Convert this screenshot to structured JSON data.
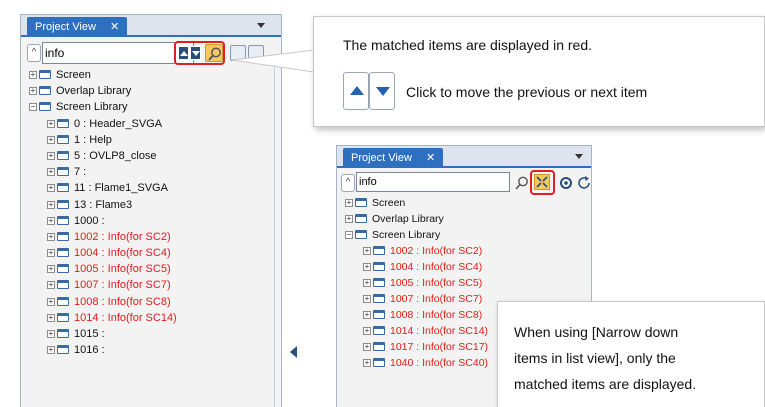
{
  "left_panel": {
    "tab_label": "Project View",
    "tab_close": "✕",
    "collapse_symbol": "^",
    "search_value": "info",
    "tree": [
      {
        "label": "Screen",
        "indent": 0,
        "match": false
      },
      {
        "label": "Overlap Library",
        "indent": 0,
        "match": false
      },
      {
        "label": "Screen Library",
        "indent": 0,
        "match": false,
        "expanded": true
      },
      {
        "label": "0 : Header_SVGA",
        "indent": 1,
        "match": false
      },
      {
        "label": "1 : Help",
        "indent": 1,
        "match": false
      },
      {
        "label": "5 : OVLP8_close",
        "indent": 1,
        "match": false
      },
      {
        "label": "7 :",
        "indent": 1,
        "match": false
      },
      {
        "label": "11 : Flame1_SVGA",
        "indent": 1,
        "match": false
      },
      {
        "label": "13 : Flame3",
        "indent": 1,
        "match": false
      },
      {
        "label": "1000 :",
        "indent": 1,
        "match": false
      },
      {
        "label": "1002 : Info(for SC2)",
        "indent": 1,
        "match": true
      },
      {
        "label": "1004 : Info(for SC4)",
        "indent": 1,
        "match": true
      },
      {
        "label": "1005 : Info(for SC5)",
        "indent": 1,
        "match": true
      },
      {
        "label": "1007 : Info(for SC7)",
        "indent": 1,
        "match": true
      },
      {
        "label": "1008 : Info(for SC8)",
        "indent": 1,
        "match": true
      },
      {
        "label": "1014 : Info(for SC14)",
        "indent": 1,
        "match": true
      },
      {
        "label": "1015 :",
        "indent": 1,
        "match": false
      },
      {
        "label": "1016 :",
        "indent": 1,
        "match": false
      }
    ]
  },
  "callout_top": {
    "line1": "The matched items are displayed in red.",
    "line2": "Click to move the previous or next item"
  },
  "right_panel": {
    "tab_label": "Project View",
    "tab_close": "✕",
    "collapse_symbol": "^",
    "search_value": "info",
    "tree": [
      {
        "label": "Screen",
        "indent": 0,
        "match": false
      },
      {
        "label": "Overlap Library",
        "indent": 0,
        "match": false
      },
      {
        "label": "Screen Library",
        "indent": 0,
        "match": false,
        "expanded": true
      },
      {
        "label": "1002 : Info(for SC2)",
        "indent": 1,
        "match": true
      },
      {
        "label": "1004 : Info(for SC4)",
        "indent": 1,
        "match": true
      },
      {
        "label": "1005 : Info(for SC5)",
        "indent": 1,
        "match": true
      },
      {
        "label": "1007 : Info(for SC7)",
        "indent": 1,
        "match": true
      },
      {
        "label": "1008 : Info(for SC8)",
        "indent": 1,
        "match": true
      },
      {
        "label": "1014 : Info(for SC14)",
        "indent": 1,
        "match": true
      },
      {
        "label": "1017 : Info(for SC17)",
        "indent": 1,
        "match": true
      },
      {
        "label": "1040 : Info(for SC40)",
        "indent": 1,
        "match": true
      }
    ]
  },
  "callout_bottom": {
    "line1": "When using [Narrow down",
    "line2": "items in list view], only the",
    "line3": "matched items are displayed."
  },
  "colors": {
    "match_text": "#e01b1b",
    "highlight_border": "#e02020",
    "tab_blue": "#2f6fbf",
    "nav_blue": "#2262b0"
  }
}
